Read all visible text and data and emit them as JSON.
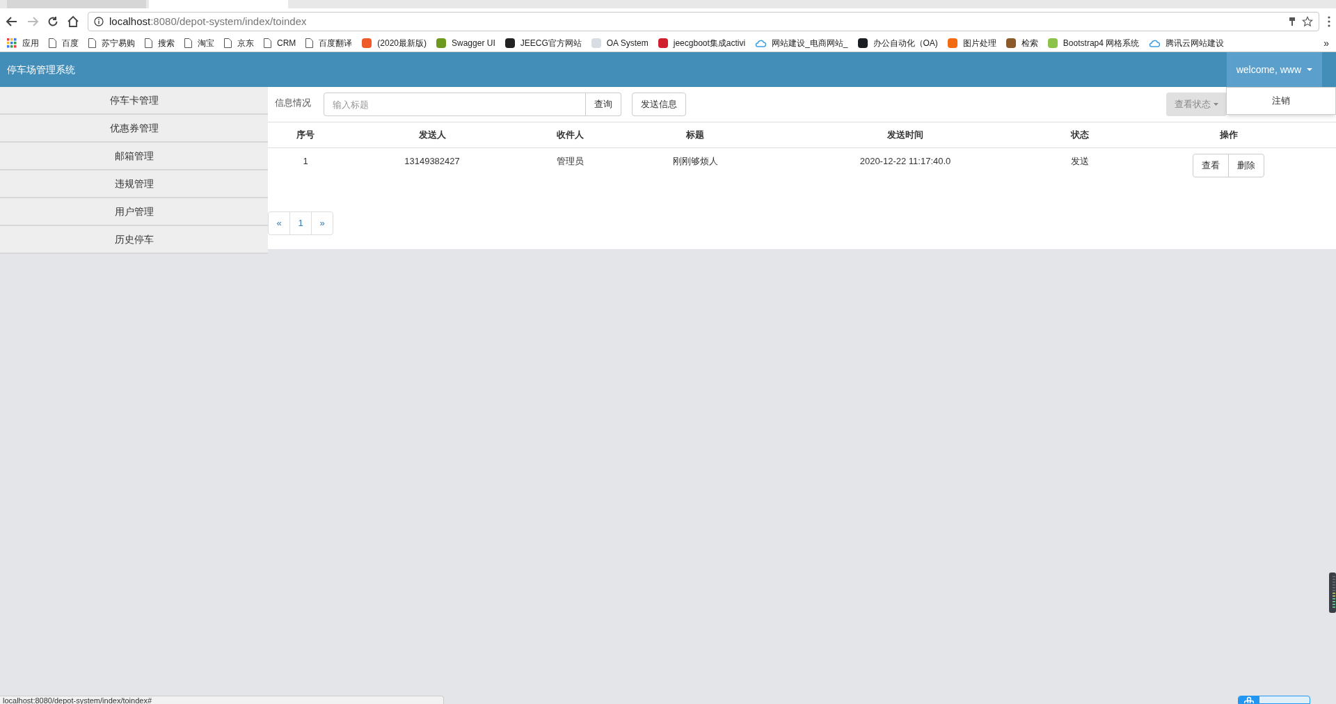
{
  "browser": {
    "tabs": [
      {
        "selected": false
      },
      {
        "selected": true
      }
    ],
    "address": {
      "host": "localhost",
      "rest": ":8080/depot-system/index/toindex"
    },
    "bookmarks": [
      {
        "kind": "apps",
        "label": "应用"
      },
      {
        "kind": "page",
        "label": "百度"
      },
      {
        "kind": "page",
        "label": "苏宁易购"
      },
      {
        "kind": "page",
        "label": "搜索"
      },
      {
        "kind": "page",
        "label": "淘宝"
      },
      {
        "kind": "page",
        "label": "京东"
      },
      {
        "kind": "page",
        "label": "CRM"
      },
      {
        "kind": "page",
        "label": "百度翻译"
      },
      {
        "kind": "logo",
        "label": "(2020最新版)",
        "color": "#f05a28"
      },
      {
        "kind": "logo",
        "label": "Swagger UI",
        "color": "#6d9a1e"
      },
      {
        "kind": "logo",
        "label": "JEECG官方网站",
        "color": "#222222"
      },
      {
        "kind": "logo",
        "label": "OA System",
        "color": "#d8dde3"
      },
      {
        "kind": "logo",
        "label": "jeecgboot集成activi",
        "color": "#d0202e"
      },
      {
        "kind": "cloud",
        "label": "网站建设_电商网站_",
        "color": "#3aa0e6"
      },
      {
        "kind": "logo",
        "label": "办公自动化（OA)",
        "color": "#1b1f23"
      },
      {
        "kind": "logo",
        "label": "图片处理",
        "color": "#f26b10"
      },
      {
        "kind": "logo",
        "label": "检索",
        "color": "#8a5a2b"
      },
      {
        "kind": "logo",
        "label": "Bootstrap4 网格系统",
        "color": "#8bc34a"
      },
      {
        "kind": "cloud",
        "label": "腾讯云网站建设",
        "color": "#3aa0e6"
      }
    ],
    "more": "»"
  },
  "app": {
    "title": "停车场管理系统",
    "user_menu": {
      "label": "welcome, www",
      "expanded": true,
      "items": [
        "注销"
      ]
    },
    "sidebar": {
      "items": [
        "停车卡管理",
        "优惠券管理",
        "邮箱管理",
        "违规管理",
        "用户管理",
        "历史停车"
      ]
    },
    "toolbar": {
      "label": "信息情况",
      "search": {
        "placeholder": "输入标题"
      },
      "search_button": "查询",
      "send_button": "发送信息",
      "status_dropdown": "查看状态"
    },
    "table": {
      "columns": [
        "序号",
        "发送人",
        "收件人",
        "标题",
        "发送时间",
        "状态",
        "操作"
      ],
      "rows": [
        {
          "cells": [
            "1",
            "13149382427",
            "管理员",
            "刚刚够烦人",
            "2020-12-22 11:17:40.0",
            "发送"
          ],
          "actions": [
            "查看",
            "删除"
          ]
        }
      ]
    },
    "pagination": [
      {
        "label": "«",
        "selected": false
      },
      {
        "label": "1",
        "selected": false
      },
      {
        "label": "»",
        "selected": false
      }
    ]
  },
  "status_bar": "localhost:8080/depot-system/index/toindex#"
}
